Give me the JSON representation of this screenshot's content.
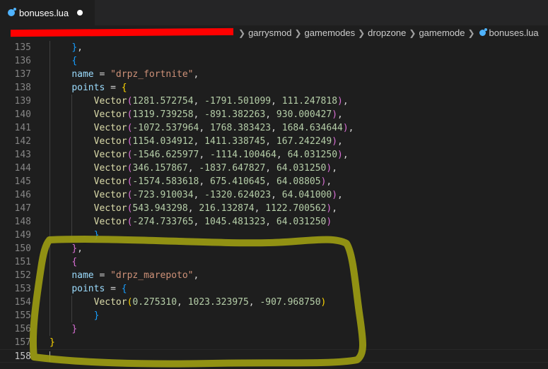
{
  "tab": {
    "title": "bonuses.lua",
    "icon": "lua-file-icon",
    "modified": true
  },
  "breadcrumb": {
    "items": [
      "garrysmod",
      "gamemodes",
      "dropzone",
      "gamemode",
      "bonuses.lua"
    ]
  },
  "colors": {
    "editor_bg": "#1e1e1e",
    "tabbar_bg": "#252526",
    "redaction": "#ff0000",
    "highlight": "#9b9b12"
  },
  "editor": {
    "lines": [
      {
        "n": "135",
        "tokens": [
          [
            "    ",
            ""
          ],
          [
            "}",
            "b2"
          ],
          [
            ",",
            "p"
          ]
        ]
      },
      {
        "n": "136",
        "tokens": [
          [
            "    ",
            ""
          ],
          [
            "{",
            "b2"
          ]
        ]
      },
      {
        "n": "137",
        "tokens": [
          [
            "    ",
            ""
          ],
          [
            "name",
            "kw"
          ],
          [
            " = ",
            "p"
          ],
          [
            "\"drpz_fortnite\"",
            "str"
          ],
          [
            ",",
            "p"
          ]
        ]
      },
      {
        "n": "138",
        "tokens": [
          [
            "    ",
            ""
          ],
          [
            "points",
            "kw"
          ],
          [
            " = ",
            "p"
          ],
          [
            "{",
            "b3"
          ]
        ]
      },
      {
        "n": "139",
        "tokens": [
          [
            "        ",
            ""
          ],
          [
            "Vector",
            "fn"
          ],
          [
            "(",
            "b1"
          ],
          [
            "1281.572754",
            "num"
          ],
          [
            ", ",
            "p"
          ],
          [
            "-1791.501099",
            "num"
          ],
          [
            ", ",
            "p"
          ],
          [
            "111.247818",
            "num"
          ],
          [
            ")",
            "b1"
          ],
          [
            ",",
            "p"
          ]
        ]
      },
      {
        "n": "140",
        "tokens": [
          [
            "        ",
            ""
          ],
          [
            "Vector",
            "fn"
          ],
          [
            "(",
            "b1"
          ],
          [
            "1319.739258",
            "num"
          ],
          [
            ", ",
            "p"
          ],
          [
            "-891.382263",
            "num"
          ],
          [
            ", ",
            "p"
          ],
          [
            "930.000427",
            "num"
          ],
          [
            ")",
            "b1"
          ],
          [
            ",",
            "p"
          ]
        ]
      },
      {
        "n": "141",
        "tokens": [
          [
            "        ",
            ""
          ],
          [
            "Vector",
            "fn"
          ],
          [
            "(",
            "b1"
          ],
          [
            "-1072.537964",
            "num"
          ],
          [
            ", ",
            "p"
          ],
          [
            "1768.383423",
            "num"
          ],
          [
            ", ",
            "p"
          ],
          [
            "1684.634644",
            "num"
          ],
          [
            ")",
            "b1"
          ],
          [
            ",",
            "p"
          ]
        ]
      },
      {
        "n": "142",
        "tokens": [
          [
            "        ",
            ""
          ],
          [
            "Vector",
            "fn"
          ],
          [
            "(",
            "b1"
          ],
          [
            "1154.034912",
            "num"
          ],
          [
            ", ",
            "p"
          ],
          [
            "1411.338745",
            "num"
          ],
          [
            ", ",
            "p"
          ],
          [
            "167.242249",
            "num"
          ],
          [
            ")",
            "b1"
          ],
          [
            ",",
            "p"
          ]
        ]
      },
      {
        "n": "143",
        "tokens": [
          [
            "        ",
            ""
          ],
          [
            "Vector",
            "fn"
          ],
          [
            "(",
            "b1"
          ],
          [
            "-1546.625977",
            "num"
          ],
          [
            ", ",
            "p"
          ],
          [
            "-1114.100464",
            "num"
          ],
          [
            ", ",
            "p"
          ],
          [
            "64.031250",
            "num"
          ],
          [
            ")",
            "b1"
          ],
          [
            ",",
            "p"
          ]
        ]
      },
      {
        "n": "144",
        "tokens": [
          [
            "        ",
            ""
          ],
          [
            "Vector",
            "fn"
          ],
          [
            "(",
            "b1"
          ],
          [
            "346.157867",
            "num"
          ],
          [
            ", ",
            "p"
          ],
          [
            "-1837.647827",
            "num"
          ],
          [
            ", ",
            "p"
          ],
          [
            "64.031250",
            "num"
          ],
          [
            ")",
            "b1"
          ],
          [
            ",",
            "p"
          ]
        ]
      },
      {
        "n": "145",
        "tokens": [
          [
            "        ",
            ""
          ],
          [
            "Vector",
            "fn"
          ],
          [
            "(",
            "b1"
          ],
          [
            "-1574.583618",
            "num"
          ],
          [
            ", ",
            "p"
          ],
          [
            "675.410645",
            "num"
          ],
          [
            ", ",
            "p"
          ],
          [
            "64.08805",
            "num"
          ],
          [
            ")",
            "b1"
          ],
          [
            ",",
            "p"
          ]
        ]
      },
      {
        "n": "146",
        "tokens": [
          [
            "        ",
            ""
          ],
          [
            "Vector",
            "fn"
          ],
          [
            "(",
            "b1"
          ],
          [
            "-723.910034",
            "num"
          ],
          [
            ", ",
            "p"
          ],
          [
            "-1320.624023",
            "num"
          ],
          [
            ", ",
            "p"
          ],
          [
            "64.041000",
            "num"
          ],
          [
            ")",
            "b1"
          ],
          [
            ",",
            "p"
          ]
        ]
      },
      {
        "n": "147",
        "tokens": [
          [
            "        ",
            ""
          ],
          [
            "Vector",
            "fn"
          ],
          [
            "(",
            "b1"
          ],
          [
            "543.943298",
            "num"
          ],
          [
            ", ",
            "p"
          ],
          [
            "216.132874",
            "num"
          ],
          [
            ", ",
            "p"
          ],
          [
            "1122.700562",
            "num"
          ],
          [
            ")",
            "b1"
          ],
          [
            ",",
            "p"
          ]
        ]
      },
      {
        "n": "148",
        "tokens": [
          [
            "        ",
            ""
          ],
          [
            "Vector",
            "fn"
          ],
          [
            "(",
            "b1"
          ],
          [
            "-274.733765",
            "num"
          ],
          [
            ", ",
            "p"
          ],
          [
            "1045.481323",
            "num"
          ],
          [
            ", ",
            "p"
          ],
          [
            "64.031250",
            "num"
          ],
          [
            ")",
            "b1"
          ]
        ]
      },
      {
        "n": "149",
        "tokens": [
          [
            "        ",
            ""
          ],
          [
            "}",
            "b2"
          ]
        ]
      },
      {
        "n": "150",
        "tokens": [
          [
            "    ",
            ""
          ],
          [
            "}",
            "b1"
          ],
          [
            ",",
            "p"
          ]
        ]
      },
      {
        "n": "151",
        "tokens": [
          [
            "    ",
            ""
          ],
          [
            "{",
            "b1"
          ]
        ]
      },
      {
        "n": "152",
        "tokens": [
          [
            "    ",
            ""
          ],
          [
            "name",
            "kw"
          ],
          [
            " = ",
            "p"
          ],
          [
            "\"drpz_marepoto\"",
            "str"
          ],
          [
            ",",
            "p"
          ]
        ]
      },
      {
        "n": "153",
        "tokens": [
          [
            "    ",
            ""
          ],
          [
            "points",
            "kw"
          ],
          [
            " = ",
            "p"
          ],
          [
            "{",
            "b2"
          ]
        ]
      },
      {
        "n": "154",
        "tokens": [
          [
            "        ",
            ""
          ],
          [
            "Vector",
            "fn"
          ],
          [
            "(",
            "b3"
          ],
          [
            "0.275310",
            "num"
          ],
          [
            ", ",
            "p"
          ],
          [
            "1023.323975",
            "num"
          ],
          [
            ", ",
            "p"
          ],
          [
            "-907.968750",
            "num"
          ],
          [
            ")",
            "b3"
          ]
        ]
      },
      {
        "n": "155",
        "tokens": [
          [
            "        ",
            ""
          ],
          [
            "}",
            "b2"
          ]
        ]
      },
      {
        "n": "156",
        "tokens": [
          [
            "    ",
            ""
          ],
          [
            "}",
            "b1"
          ]
        ]
      },
      {
        "n": "157",
        "tokens": [
          [
            "",
            ""
          ],
          [
            "}",
            "b3"
          ]
        ]
      },
      {
        "n": "158",
        "tokens": []
      }
    ]
  }
}
